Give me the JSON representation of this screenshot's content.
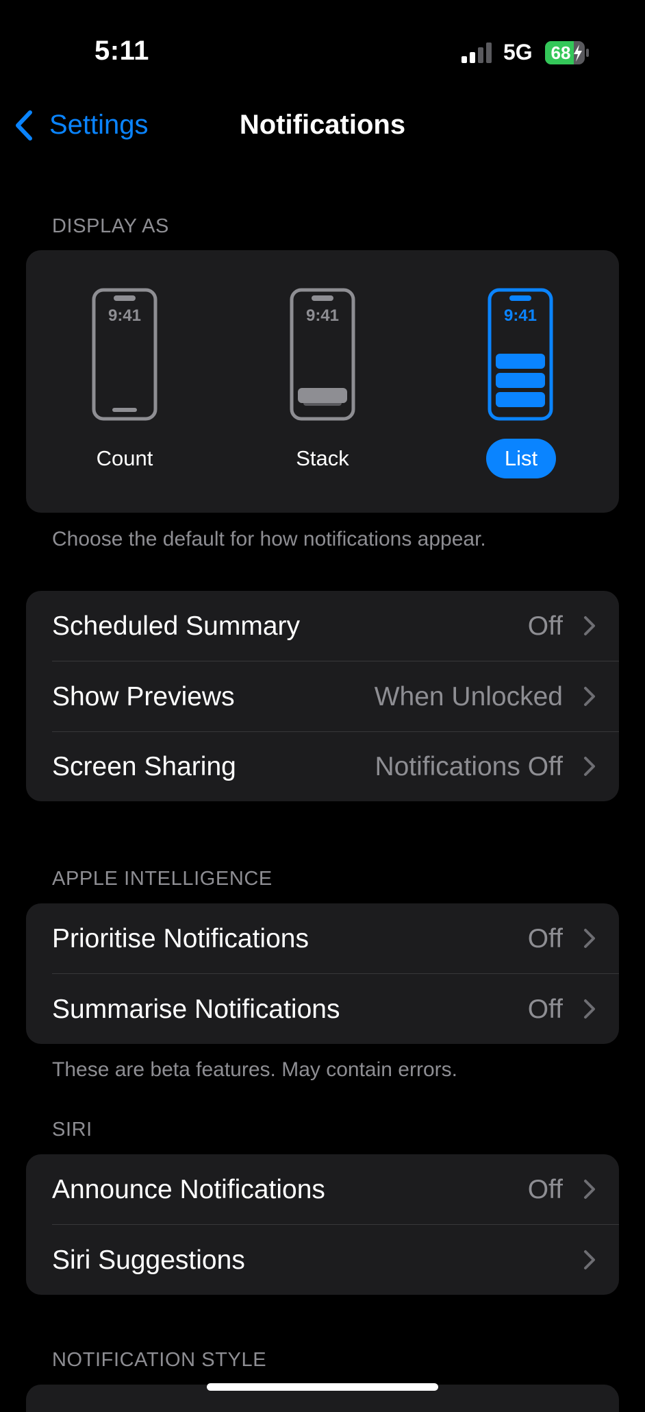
{
  "status_bar": {
    "time": "5:11",
    "network": "5G",
    "battery": "68"
  },
  "nav": {
    "back_label": "Settings",
    "title": "Notifications"
  },
  "display_as": {
    "header": "DISPLAY AS",
    "phone_time": "9:41",
    "options": [
      {
        "label": "Count",
        "selected": false
      },
      {
        "label": "Stack",
        "selected": false
      },
      {
        "label": "List",
        "selected": true
      }
    ],
    "footer": "Choose the default for how notifications appear."
  },
  "general": {
    "rows": [
      {
        "label": "Scheduled Summary",
        "value": "Off"
      },
      {
        "label": "Show Previews",
        "value": "When Unlocked"
      },
      {
        "label": "Screen Sharing",
        "value": "Notifications Off"
      }
    ]
  },
  "apple_intelligence": {
    "header": "APPLE INTELLIGENCE",
    "rows": [
      {
        "label": "Prioritise Notifications",
        "value": "Off"
      },
      {
        "label": "Summarise Notifications",
        "value": "Off"
      }
    ],
    "footer": "These are beta features. May contain errors."
  },
  "siri": {
    "header": "SIRI",
    "rows": [
      {
        "label": "Announce Notifications",
        "value": "Off"
      },
      {
        "label": "Siri Suggestions",
        "value": ""
      }
    ]
  },
  "notification_style": {
    "header": "NOTIFICATION STYLE"
  },
  "colors": {
    "accent": "#0a84ff",
    "background": "#000000",
    "group_background": "#1c1c1e",
    "secondary_text": "#8e8e93",
    "battery_green": "#34c759"
  }
}
